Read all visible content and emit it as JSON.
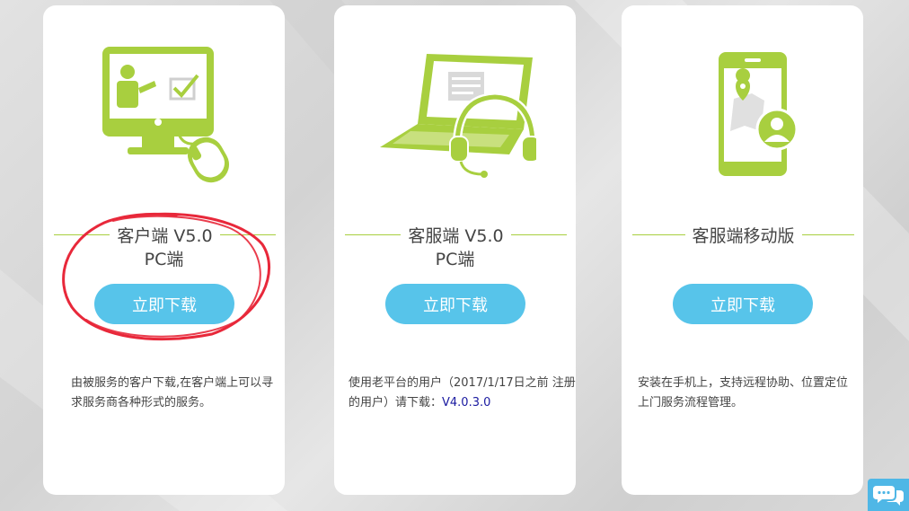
{
  "cards": [
    {
      "icon": "monitor-presentation-icon",
      "title": "客户端 V5.0",
      "subtitle": "PC端",
      "button_label": "立即下载",
      "description": "由被服务的客户下载,在客户端上可以寻求服务商各种形式的服务。"
    },
    {
      "icon": "laptop-headset-icon",
      "title": "客服端 V5.0",
      "subtitle": "PC端",
      "button_label": "立即下载",
      "description_prefix": "使用老平台的用户（2017/1/17日之前 注册的用户）请下载：",
      "description_version": "V4.0.3.0"
    },
    {
      "icon": "mobile-map-icon",
      "title": "客服端移动版",
      "button_label": "立即下载",
      "description": "安装在手机上，支持远程协助、位置定位上门服务流程管理。"
    }
  ],
  "annotation": {
    "type": "red-hand-drawn-circle",
    "color": "#e8283a"
  },
  "colors": {
    "accent_green": "#a8cf3f",
    "button_blue": "#57c4ea",
    "annotation_red": "#e8283a",
    "chat_blue": "#4fb7e6"
  },
  "chat_widget": {
    "icon": "chat-bubbles-icon"
  }
}
